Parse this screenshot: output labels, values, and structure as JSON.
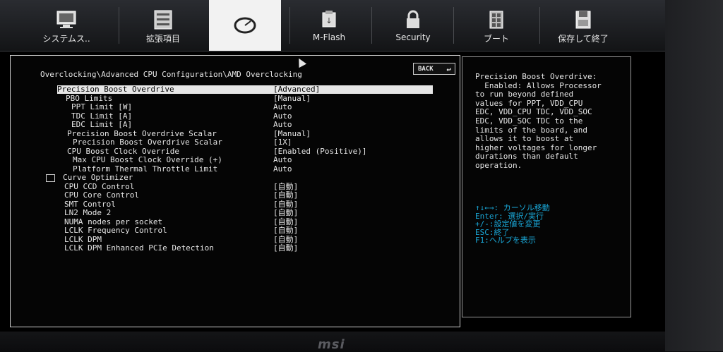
{
  "top_nav": {
    "tabs": [
      {
        "label": "システムス..",
        "icon": "system-status-icon",
        "active": false
      },
      {
        "label": "拡張項目",
        "icon": "settings-icon",
        "active": false
      },
      {
        "label": "",
        "icon": "overclock-gauge-icon",
        "active": true
      },
      {
        "label": "M-Flash",
        "icon": "m-flash-icon",
        "active": false
      },
      {
        "label": "Security",
        "icon": "security-icon",
        "active": false
      },
      {
        "label": "ブート",
        "icon": "boot-icon",
        "active": false
      },
      {
        "label": "保存して終了",
        "icon": "save-exit-icon",
        "active": false
      }
    ]
  },
  "main": {
    "breadcrumb": "Overclocking\\Advanced CPU Configuration\\AMD Overclocking",
    "back_button": "BACK",
    "settings": [
      {
        "name": "Precision Boost Overdrive",
        "value": "[Advanced]",
        "selected": true
      },
      {
        "name": "PBO Limits",
        "value": "[Manual]"
      },
      {
        "name": "PPT Limit [W]",
        "value": "Auto"
      },
      {
        "name": "TDC Limit [A]",
        "value": "Auto"
      },
      {
        "name": "EDC Limit [A]",
        "value": "Auto"
      },
      {
        "name": "Precision Boost Overdrive Scalar",
        "value": "[Manual]"
      },
      {
        "name": "Precision Boost Overdrive Scalar",
        "value": "[1X]"
      },
      {
        "name": "CPU Boost Clock Override",
        "value": "[Enabled (Positive)]"
      },
      {
        "name": "Max CPU Boost Clock Override (+)",
        "value": "Auto"
      },
      {
        "name": "Platform Thermal Throttle Limit",
        "value": "Auto"
      },
      {
        "name": "Curve Optimizer",
        "value": ""
      },
      {
        "name": "CPU CCD Control",
        "value": "[自動]"
      },
      {
        "name": "CPU Core Control",
        "value": "[自動]"
      },
      {
        "name": "SMT Control",
        "value": "[自動]"
      },
      {
        "name": "LN2 Mode 2",
        "value": "[自動]"
      },
      {
        "name": "NUMA nodes per socket",
        "value": "[自動]"
      },
      {
        "name": "LCLK Frequency Control",
        "value": "[自動]"
      },
      {
        "name": "LCLK DPM",
        "value": "[自動]"
      },
      {
        "name": "LCLK DPM Enhanced PCIe Detection",
        "value": "[自動]"
      }
    ]
  },
  "help": {
    "description": "Precision Boost Overdrive:\n  Enabled: Allows Processor\nto run beyond defined\nvalues for PPT, VDD_CPU\nEDC, VDD_CPU TDC, VDD_SOC\nEDC, VDD_SOC TDC to the\nlimits of the board, and\nallows it to boost at\nhigher voltages for longer\ndurations than default\noperation.",
    "keys": "↑↓←→: カーソル移動\nEnter: 選択/実行\n+/-:設定値を変更\nESC:終了\nF1:ヘルプを表示"
  },
  "monitor_brand": "msi",
  "colors": {
    "key_help": "#1aa8d8",
    "selection_bg": "#e6e6e6"
  }
}
